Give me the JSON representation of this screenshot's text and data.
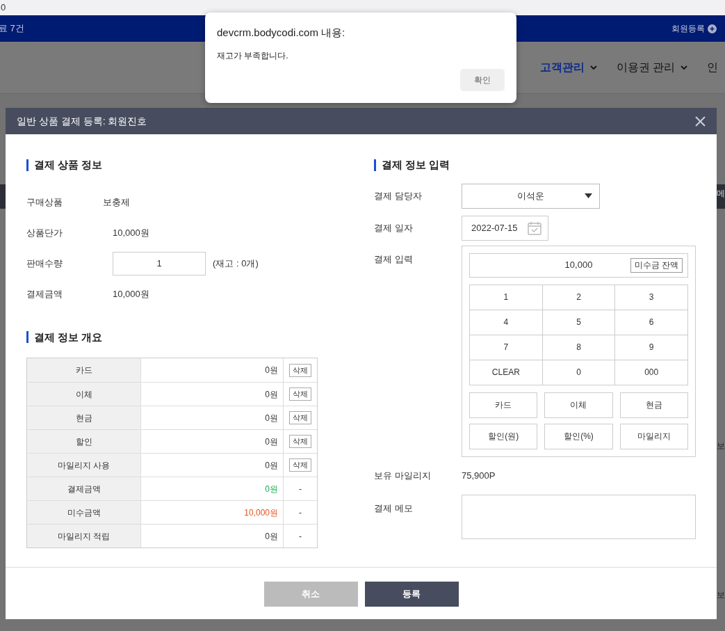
{
  "browser": {
    "address_fragment": "0"
  },
  "top_bar": {
    "count_text": "료 7건",
    "register_link": "회원등록"
  },
  "nav": {
    "items": [
      {
        "label": "고객관리",
        "selected": true,
        "dropdown": true
      },
      {
        "label": "이용권 관리",
        "selected": false,
        "dropdown": true
      },
      {
        "label": "인",
        "selected": false,
        "dropdown": false
      }
    ]
  },
  "background_fragments": [
    "메",
    "보",
    "보"
  ],
  "alert": {
    "title": "devcrm.bodycodi.com 내용:",
    "message": "재고가 부족합니다.",
    "button": "확인"
  },
  "modal": {
    "title": "일반 상품 결제 등록: 회원진호",
    "product_section": {
      "title": "결제 상품 정보",
      "rows": [
        {
          "kind": "text",
          "label": "구매상품",
          "value": "보충제"
        },
        {
          "kind": "text",
          "label": "상품단가",
          "value": "10,000원"
        },
        {
          "kind": "input",
          "label": "판매수량",
          "value": "1",
          "note": "(재고 : 0개)"
        },
        {
          "kind": "text",
          "label": "결제금액",
          "value": "10,000원"
        }
      ]
    },
    "summary_section": {
      "title": "결제 정보 개요",
      "rows": [
        {
          "label": "카드",
          "amount": "0원",
          "kind": "plain",
          "action": {
            "kind": "button",
            "label": "삭제"
          }
        },
        {
          "label": "이체",
          "amount": "0원",
          "kind": "plain",
          "action": {
            "kind": "button",
            "label": "삭제"
          }
        },
        {
          "label": "현금",
          "amount": "0원",
          "kind": "plain",
          "action": {
            "kind": "button",
            "label": "삭제"
          }
        },
        {
          "label": "할인",
          "amount": "0원",
          "kind": "plain",
          "action": {
            "kind": "button",
            "label": "삭제"
          }
        },
        {
          "label": "마일리지 사용",
          "amount": "0원",
          "kind": "plain",
          "action": {
            "kind": "button",
            "label": "삭제"
          }
        },
        {
          "label": "결제금액",
          "amount": "0원",
          "kind": "paid",
          "action": {
            "kind": "text",
            "label": "-"
          }
        },
        {
          "label": "미수금액",
          "amount": "10,000원",
          "kind": "due",
          "action": {
            "kind": "text",
            "label": "-"
          }
        },
        {
          "label": "마일리지 적립",
          "amount": "0원",
          "kind": "plain",
          "action": {
            "kind": "text",
            "label": "-"
          }
        }
      ]
    },
    "payment_section": {
      "title": "결제 정보 입력",
      "staff": {
        "label": "결제 담당자",
        "value": "이석운"
      },
      "date": {
        "label": "결제 일자",
        "value": "2022-07-15"
      },
      "input": {
        "label": "결제 입력",
        "amount": "10,000",
        "balance_button": "미수금 잔액",
        "keys": [
          "1",
          "2",
          "3",
          "4",
          "5",
          "6",
          "7",
          "8",
          "9",
          "CLEAR",
          "0",
          "000"
        ],
        "methods": [
          "카드",
          "이체",
          "현금",
          "할인(원)",
          "할인(%)",
          "마일리지"
        ]
      },
      "mileage": {
        "label": "보유 마일리지",
        "value": "75,900P"
      },
      "memo": {
        "label": "결제 메모"
      }
    },
    "buttons": [
      {
        "kind": "cancel",
        "label": "취소"
      },
      {
        "kind": "submit",
        "label": "등록"
      }
    ]
  }
}
